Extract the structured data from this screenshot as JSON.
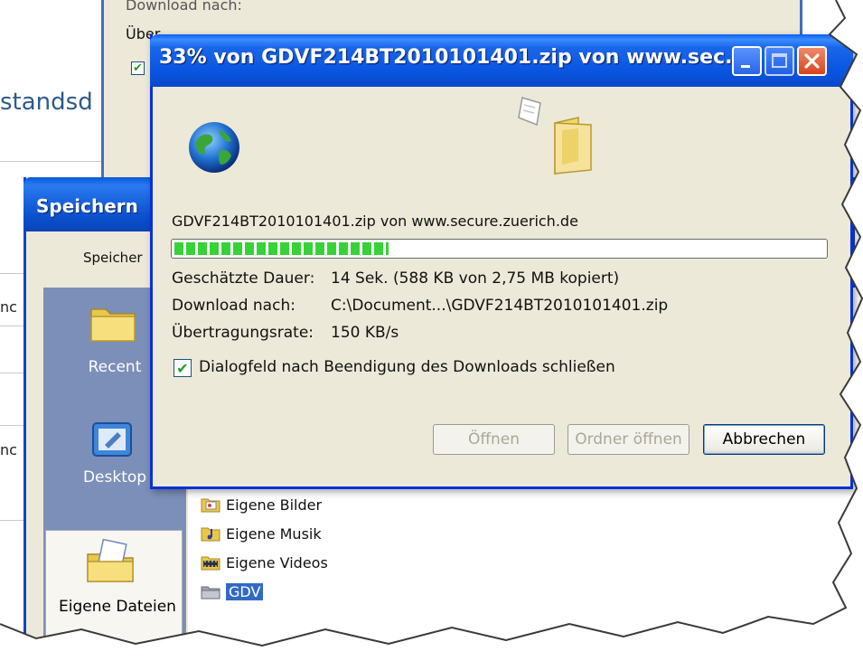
{
  "background_page": {
    "title_fragment": "standsd",
    "row_fragments": [
      "nc",
      "nc"
    ]
  },
  "old_download_window": {
    "line1": "Download nach:",
    "line2": "Über",
    "checkbox_checked": true
  },
  "save_dialog": {
    "title": "Speichern",
    "save_in_label": "Speicher",
    "places": [
      {
        "label": "Recent",
        "icon": "recent-folder-icon"
      },
      {
        "label": "Desktop",
        "icon": "desktop-icon"
      },
      {
        "label": "Eigene Dateien",
        "icon": "my-documents-icon",
        "selected": true
      }
    ],
    "files": [
      {
        "name": "Eigene Bilder",
        "icon": "pictures-folder-icon"
      },
      {
        "name": "Eigene Musik",
        "icon": "music-folder-icon"
      },
      {
        "name": "Eigene Videos",
        "icon": "videos-folder-icon"
      },
      {
        "name": "GDV",
        "icon": "folder-icon",
        "selected": true
      }
    ]
  },
  "download_dialog": {
    "title": "33% von GDVF214BT2010101401.zip von www.sec...",
    "file_source": "GDVF214BT2010101401.zip von www.secure.zuerich.de",
    "progress_fraction": 0.33,
    "estimated_time_label": "Geschätzte Dauer:",
    "estimated_time_value": "14 Sek. (588 KB von 2,75 MB kopiert)",
    "download_to_label": "Download nach:",
    "download_to_value": "C:\\Document...\\GDVF214BT2010101401.zip",
    "transfer_rate_label": "Übertragungsrate:",
    "transfer_rate_value": "150 KB/s",
    "close_when_done_label": "Dialogfeld nach Beendigung des Downloads schließen",
    "close_when_done_checked": true,
    "buttons": {
      "open": "Öffnen",
      "open_folder": "Ordner öffnen",
      "cancel": "Abbrechen"
    }
  },
  "colors": {
    "xp_blue": "#0a55e0",
    "dialog_face": "#ece9d8",
    "progress_green": "#37d237"
  }
}
